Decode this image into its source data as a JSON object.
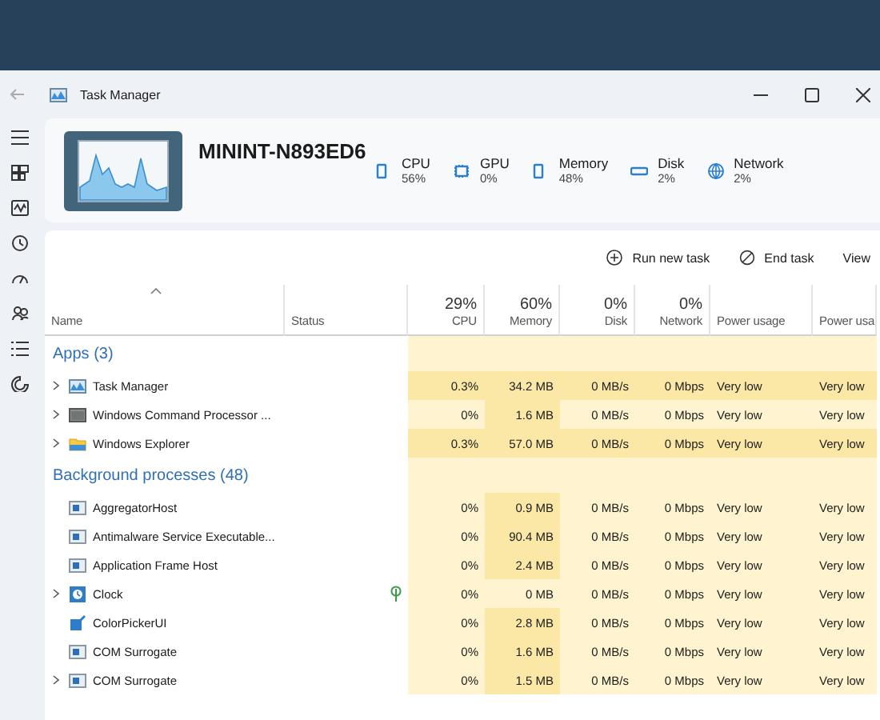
{
  "window": {
    "title": "Task Manager"
  },
  "machine": {
    "name": "MININT-N893ED6"
  },
  "summary": [
    {
      "kind": "cpu",
      "label": "CPU",
      "value": "56%"
    },
    {
      "kind": "gpu",
      "label": "GPU",
      "value": "0%"
    },
    {
      "kind": "memory",
      "label": "Memory",
      "value": "48%"
    },
    {
      "kind": "disk",
      "label": "Disk",
      "value": "2%"
    },
    {
      "kind": "network",
      "label": "Network",
      "value": "2%"
    }
  ],
  "toolbar": {
    "run_new_task": "Run new task",
    "end_task": "End task",
    "view": "View"
  },
  "table": {
    "columns": [
      {
        "kind": "name",
        "label": "Name"
      },
      {
        "kind": "status",
        "label": "Status"
      },
      {
        "kind": "num",
        "total": "29%",
        "label": "CPU"
      },
      {
        "kind": "num",
        "total": "60%",
        "label": "Memory"
      },
      {
        "kind": "num",
        "total": "0%",
        "label": "Disk"
      },
      {
        "kind": "num",
        "total": "0%",
        "label": "Network"
      },
      {
        "kind": "text",
        "label": "Power usage"
      },
      {
        "kind": "text",
        "label": "Power usa"
      }
    ],
    "groups": [
      {
        "title": "Apps (3)",
        "rows": [
          {
            "kind": "monitor",
            "expandable": true,
            "name": "Task Manager",
            "efficiency_mode": false,
            "cpu": "0.3%",
            "memory": "34.2 MB",
            "disk": "0 MB/s",
            "network": "0 Mbps",
            "power": "Very low",
            "power_trend": "Very low",
            "cpu_heat": true,
            "memory_heat": true
          },
          {
            "kind": "console",
            "expandable": true,
            "name": "Windows Command Processor ...",
            "efficiency_mode": false,
            "cpu": "0%",
            "memory": "1.6 MB",
            "disk": "0 MB/s",
            "network": "0 Mbps",
            "power": "Very low",
            "power_trend": "Very low",
            "cpu_heat": false,
            "memory_heat": true
          },
          {
            "kind": "folder",
            "expandable": true,
            "name": "Windows Explorer",
            "efficiency_mode": false,
            "cpu": "0.3%",
            "memory": "57.0 MB",
            "disk": "0 MB/s",
            "network": "0 Mbps",
            "power": "Very low",
            "power_trend": "Very low",
            "cpu_heat": true,
            "memory_heat": true
          }
        ]
      },
      {
        "title": "Background processes (48)",
        "rows": [
          {
            "kind": "service",
            "expandable": false,
            "name": "AggregatorHost",
            "efficiency_mode": false,
            "cpu": "0%",
            "memory": "0.9 MB",
            "disk": "0 MB/s",
            "network": "0 Mbps",
            "power": "Very low",
            "power_trend": "Very low",
            "cpu_heat": false,
            "memory_heat": true
          },
          {
            "kind": "service",
            "expandable": false,
            "name": "Antimalware Service Executable...",
            "efficiency_mode": false,
            "cpu": "0%",
            "memory": "90.4 MB",
            "disk": "0 MB/s",
            "network": "0 Mbps",
            "power": "Very low",
            "power_trend": "Very low",
            "cpu_heat": false,
            "memory_heat": true
          },
          {
            "kind": "service",
            "expandable": false,
            "name": "Application Frame Host",
            "efficiency_mode": false,
            "cpu": "0%",
            "memory": "2.4 MB",
            "disk": "0 MB/s",
            "network": "0 Mbps",
            "power": "Very low",
            "power_trend": "Very low",
            "cpu_heat": false,
            "memory_heat": true
          },
          {
            "kind": "clock",
            "expandable": true,
            "name": "Clock",
            "efficiency_mode": true,
            "cpu": "0%",
            "memory": "0 MB",
            "disk": "0 MB/s",
            "network": "0 Mbps",
            "power": "Very low",
            "power_trend": "Very low",
            "cpu_heat": false,
            "memory_heat": false
          },
          {
            "kind": "picker",
            "expandable": false,
            "name": "ColorPickerUI",
            "efficiency_mode": false,
            "cpu": "0%",
            "memory": "2.8 MB",
            "disk": "0 MB/s",
            "network": "0 Mbps",
            "power": "Very low",
            "power_trend": "Very low",
            "cpu_heat": false,
            "memory_heat": true
          },
          {
            "kind": "service",
            "expandable": false,
            "name": "COM Surrogate",
            "efficiency_mode": false,
            "cpu": "0%",
            "memory": "1.6 MB",
            "disk": "0 MB/s",
            "network": "0 Mbps",
            "power": "Very low",
            "power_trend": "Very low",
            "cpu_heat": false,
            "memory_heat": true
          },
          {
            "kind": "service",
            "expandable": true,
            "name": "COM Surrogate",
            "efficiency_mode": false,
            "cpu": "0%",
            "memory": "1.5 MB",
            "disk": "0 MB/s",
            "network": "0 Mbps",
            "power": "Very low",
            "power_trend": "Very low",
            "cpu_heat": false,
            "memory_heat": true
          }
        ]
      }
    ]
  }
}
